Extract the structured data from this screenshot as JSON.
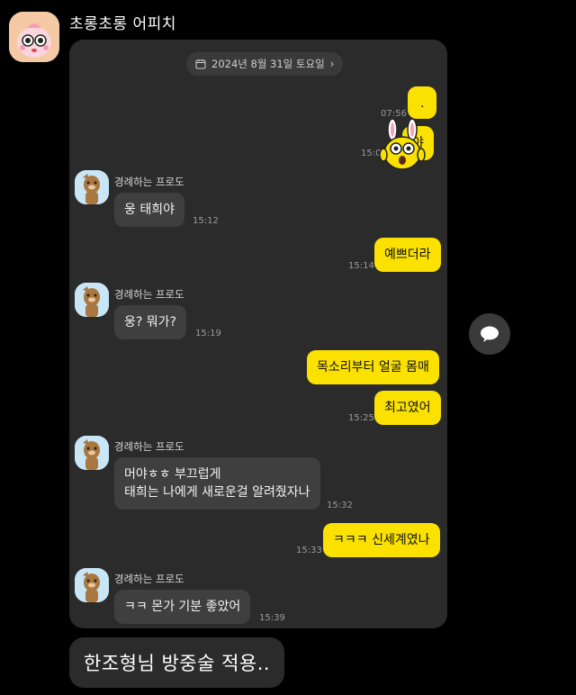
{
  "header": {
    "title": "초롱초롱 어피치"
  },
  "chat": {
    "date": "2024년 8월 31일 토요일",
    "sender_name": "경례하는 프로도",
    "messages": [
      {
        "text": ".",
        "time": "07:56"
      },
      {
        "text": "야",
        "time": "15:0"
      },
      {
        "text": "웅 태희야",
        "time": "15:12"
      },
      {
        "text": "예쁘더라",
        "time": "15:14"
      },
      {
        "text": "웅? 뭐가?",
        "time": "15:19"
      },
      {
        "text": "목소리부터 얼굴 몸매",
        "time": ""
      },
      {
        "text": "최고였어",
        "time": "15:25"
      },
      {
        "text": "머야ㅎㅎ 부끄럽게",
        "text2": "태희는 나에게 새로운걸 알려줬자나",
        "time": "15:32"
      },
      {
        "text": "ㅋㅋㅋ 신세계였나",
        "time": "15:33"
      },
      {
        "text": "ㅋㅋ 몬가 기분 좋았어",
        "time": "15:39"
      }
    ]
  },
  "caption": {
    "text": "한조형님 방중술 적용.."
  },
  "icons": {
    "calendar": "calendar-icon",
    "chevron": "chevron-right-icon",
    "chat": "chat-bubble-icon"
  },
  "colors": {
    "outgoing_bubble": "#fae100",
    "incoming_bubble": "#3f3f3f",
    "card_bg": "#2b2b2b",
    "page_bg": "#000000"
  }
}
